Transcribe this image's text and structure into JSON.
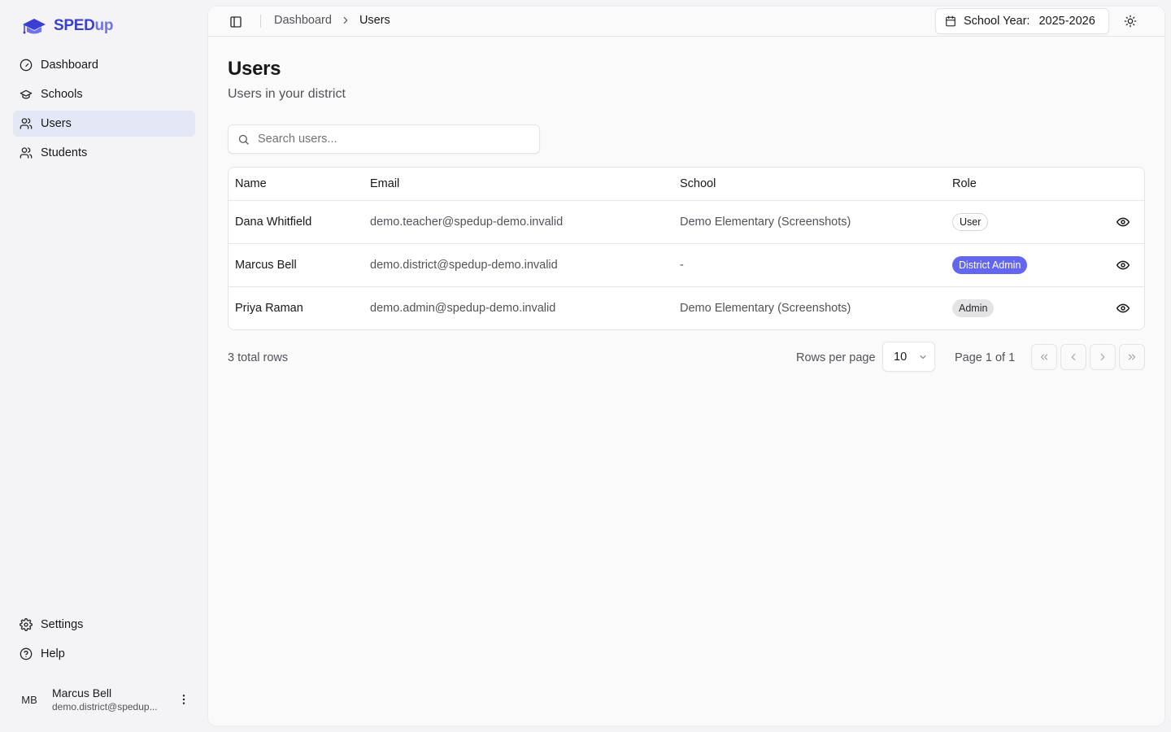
{
  "brand": {
    "name_part1": "SPED",
    "name_part2": "up"
  },
  "sidebar": {
    "items": [
      {
        "label": "Dashboard",
        "icon": "gauge-icon",
        "active": false
      },
      {
        "label": "Schools",
        "icon": "graduation-cap-icon",
        "active": false
      },
      {
        "label": "Users",
        "icon": "users-icon",
        "active": true
      },
      {
        "label": "Students",
        "icon": "users-icon",
        "active": false
      }
    ],
    "bottom_items": [
      {
        "label": "Settings",
        "icon": "gear-icon"
      },
      {
        "label": "Help",
        "icon": "help-circle-icon"
      }
    ],
    "user": {
      "initials": "MB",
      "name": "Marcus Bell",
      "email": "demo.district@spedup..."
    }
  },
  "header": {
    "breadcrumb": {
      "parent": "Dashboard",
      "current": "Users"
    },
    "school_year": {
      "label": "School Year:",
      "value": "2025-2026"
    }
  },
  "page": {
    "title": "Users",
    "subtitle": "Users in your district"
  },
  "search": {
    "placeholder": "Search users...",
    "value": ""
  },
  "table": {
    "columns": [
      "Name",
      "Email",
      "School",
      "Role"
    ],
    "rows": [
      {
        "name": "Dana Whitfield",
        "email": "demo.teacher@spedup-demo.invalid",
        "school": "Demo Elementary (Screenshots)",
        "role": "User"
      },
      {
        "name": "Marcus Bell",
        "email": "demo.district@spedup-demo.invalid",
        "school": "-",
        "role": "District Admin"
      },
      {
        "name": "Priya Raman",
        "email": "demo.admin@spedup-demo.invalid",
        "school": "Demo Elementary (Screenshots)",
        "role": "Admin"
      }
    ]
  },
  "pagination": {
    "total": "3 total rows",
    "rows_per_page_label": "Rows per page",
    "rows_per_page": "10",
    "page_info": "Page 1 of 1"
  },
  "colors": {
    "accent": "#6366f1",
    "active_nav": "#e3e7f6",
    "brand": "#3b3fd1"
  }
}
